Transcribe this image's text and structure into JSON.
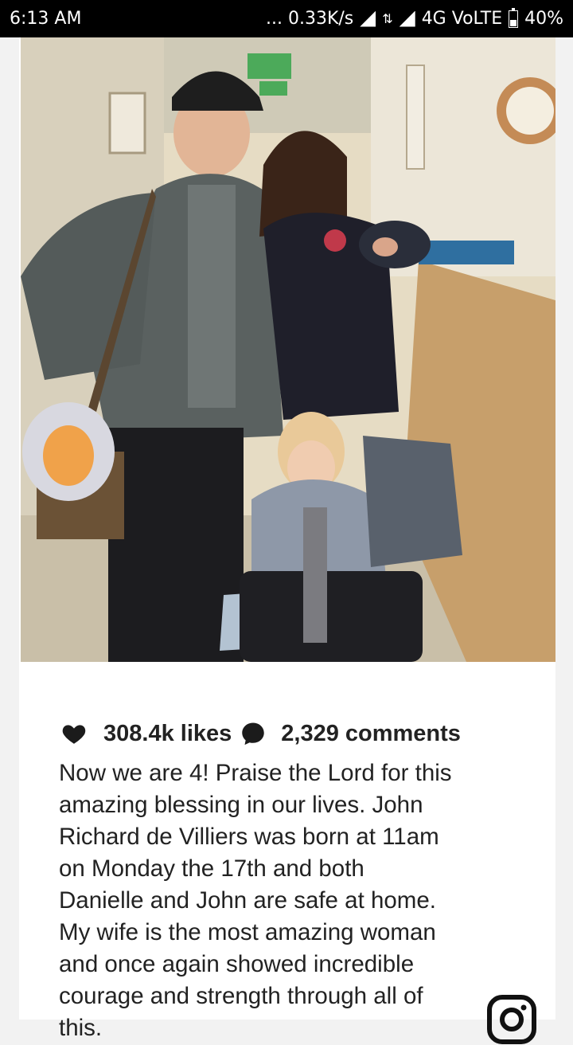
{
  "status_bar": {
    "time": "6:13 AM",
    "network_speed": "... 0.33K/s",
    "network_type": "4G VoLTE",
    "battery": "40%",
    "battery_level": 0.4
  },
  "post": {
    "photo_alt": "Family photo in hospital corridor",
    "likes": "308.4k likes",
    "comments": "2,329 comments",
    "caption": "Now we are 4! Praise the Lord for this\namazing blessing in our lives. John\nRichard de Villiers was born at 11am\non Monday the 17th and both\nDanielle and John are safe at home.\nMy wife is the most amazing woman\nand once again showed incredible\ncourage and strength through all of\nthis."
  },
  "icons": {
    "like": "heart-icon",
    "comment": "comment-icon",
    "brand": "instagram-icon"
  },
  "colors": {
    "status_bar": "#000000",
    "text": "#222222",
    "background": "#f2f2f2"
  }
}
